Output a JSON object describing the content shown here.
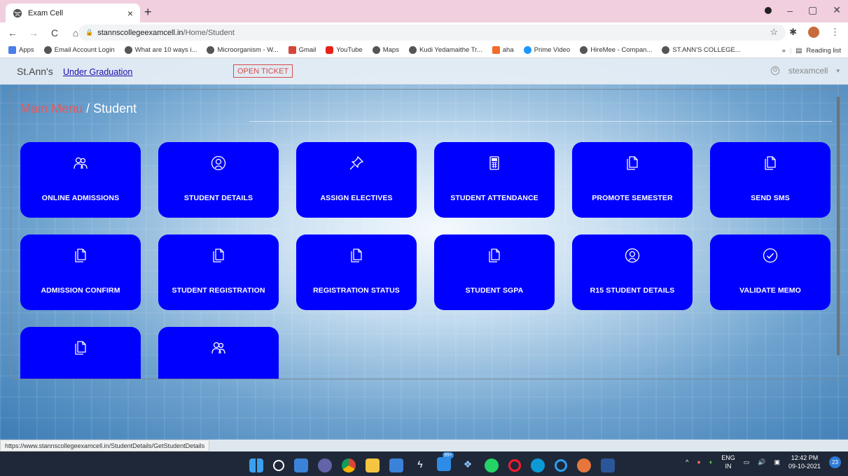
{
  "browser": {
    "tab_title": "Exam Cell",
    "url_host": "stannscollegeexamcell.in",
    "url_path": "/Home/Student",
    "status_url": "https://www.stannscollegeexamcell.in/StudentDetails/GetStudentDetails",
    "bookmarks": [
      {
        "label": "Apps",
        "icon": "apps-grid-icon"
      },
      {
        "label": "Email Account Login",
        "icon": "globe-icon"
      },
      {
        "label": "What are 10 ways i...",
        "icon": "globe-icon"
      },
      {
        "label": "Microorganism - W...",
        "icon": "globe-icon"
      },
      {
        "label": "Gmail",
        "icon": "gmail-icon"
      },
      {
        "label": "YouTube",
        "icon": "youtube-icon"
      },
      {
        "label": "Maps",
        "icon": "globe-icon"
      },
      {
        "label": "Kudi Yedamaithe Tr...",
        "icon": "globe-icon"
      },
      {
        "label": "aha",
        "icon": "aha-icon"
      },
      {
        "label": "Prime Video",
        "icon": "prime-video-icon"
      },
      {
        "label": "HireMee - Compan...",
        "icon": "globe-icon"
      },
      {
        "label": "ST.ANN'S COLLEGE...",
        "icon": "globe-icon"
      }
    ],
    "more_bookmarks": "»",
    "reading_list": "Reading list"
  },
  "app": {
    "brand": "St.Ann's",
    "nav_link": "Under Graduation",
    "ticket_button": "OPEN TICKET",
    "username": "stexamcell",
    "breadcrumb_main": "Main Menu",
    "breadcrumb_sep": " / ",
    "breadcrumb_current": "Student"
  },
  "tiles": [
    {
      "label": "ONLINE ADMISSIONS",
      "icon": "users-icon"
    },
    {
      "label": "STUDENT DETAILS",
      "icon": "user-circle-icon"
    },
    {
      "label": "ASSIGN ELECTIVES",
      "icon": "pushpin-icon"
    },
    {
      "label": "STUDENT ATTENDANCE",
      "icon": "calculator-icon"
    },
    {
      "label": "PROMOTE SEMESTER",
      "icon": "documents-icon"
    },
    {
      "label": "SEND SMS",
      "icon": "documents-icon"
    },
    {
      "label": "ADMISSION CONFIRM",
      "icon": "documents-icon"
    },
    {
      "label": "STUDENT REGISTRATION",
      "icon": "documents-icon"
    },
    {
      "label": "REGISTRATION STATUS",
      "icon": "documents-icon"
    },
    {
      "label": "STUDENT SGPA",
      "icon": "documents-icon"
    },
    {
      "label": "R15 STUDENT DETAILS",
      "icon": "user-circle-icon"
    },
    {
      "label": "VALIDATE MEMO",
      "icon": "check-circle-icon"
    },
    {
      "label": "",
      "icon": "documents-icon"
    },
    {
      "label": "",
      "icon": "users-icon"
    }
  ],
  "taskbar": {
    "badge": "99+",
    "lang_top": "ENG",
    "lang_bottom": "IN",
    "time": "12:42 PM",
    "date": "09-10-2021",
    "notifications": "23"
  },
  "colors": {
    "tile_blue": "#0000ff",
    "breadcrumb_red": "#e35b5b",
    "ticket_red": "#d94b4b",
    "tab_strip": "#f1cfdf"
  }
}
